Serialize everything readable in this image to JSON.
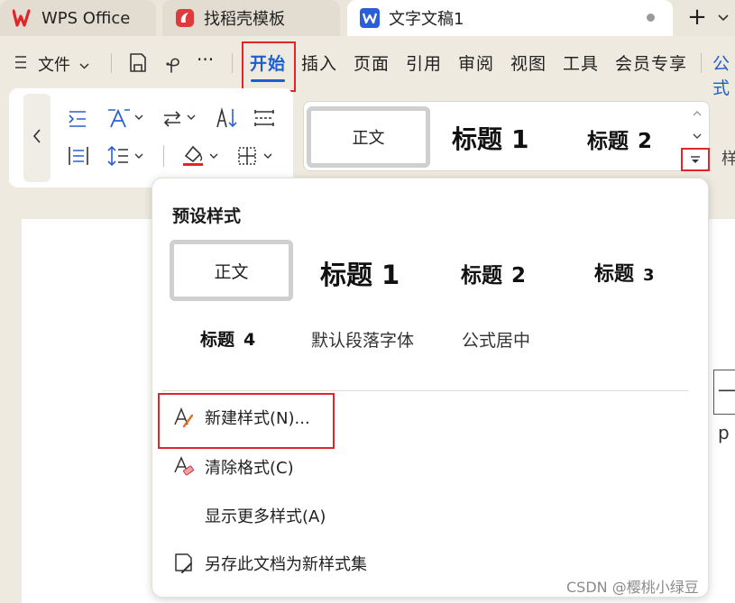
{
  "tabs": {
    "wps": "WPS Office",
    "template": "找稻壳模板",
    "document": "文字文稿1",
    "add": "+"
  },
  "menubar": {
    "file": "文件",
    "more": "···",
    "items": [
      "开始",
      "插入",
      "页面",
      "引用",
      "审阅",
      "视图",
      "工具",
      "会员专享",
      "公式"
    ]
  },
  "ribbon_styles": {
    "normal": "正文",
    "heading1": "标题",
    "heading1_num": "1",
    "heading2": "标题",
    "heading2_num": "2",
    "side_label": "样"
  },
  "dropdown": {
    "title": "预设样式",
    "normal": "正文",
    "heading1": "标题",
    "heading1_num": "1",
    "heading2": "标题",
    "heading2_num": "2",
    "heading3": "标题",
    "heading3_num": "3",
    "heading4": "标题",
    "heading4_num": "4",
    "default_font": "默认段落字体",
    "formula_center": "公式居中",
    "actions": {
      "new_style": "新建样式(N)...",
      "clear_format": "清除格式(C)",
      "show_more": "显示更多样式(A)",
      "save_as_set": "另存此文档为新样式集"
    }
  },
  "ruler_hint": "一 p",
  "watermark": "CSDN @樱桃小绿豆",
  "colors": {
    "accent_blue": "#1a5fd1",
    "wps_red": "#e0252b",
    "highlight_red": "#e0252b",
    "background": "#efeae0"
  },
  "icons": [
    "wps-logo-icon",
    "docer-logo-icon",
    "word-doc-icon",
    "menu-icon",
    "save-icon",
    "undo-icon"
  ]
}
